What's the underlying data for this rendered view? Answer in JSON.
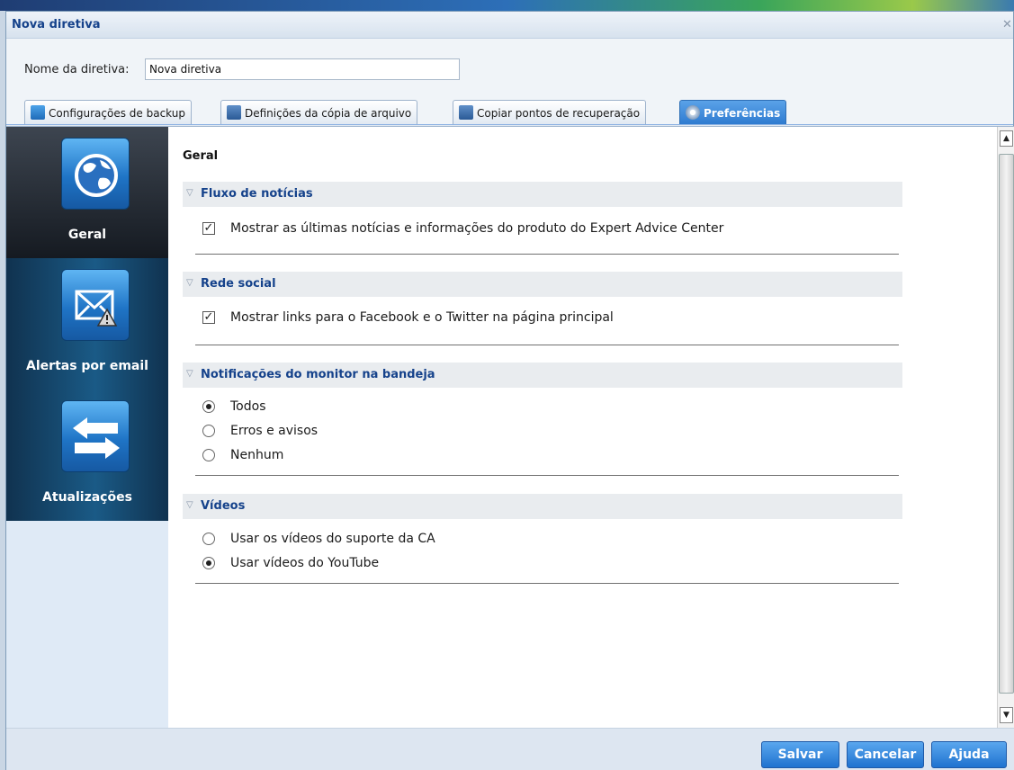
{
  "window": {
    "title": "Nova diretiva"
  },
  "name_row": {
    "label": "Nome da diretiva:",
    "value": "Nova diretiva"
  },
  "tabs": [
    {
      "label": "Configurações de backup",
      "icon": "backup-icon"
    },
    {
      "label": "Definições da cópia de arquivo",
      "icon": "file-copy-icon"
    },
    {
      "label": "Copiar pontos de recuperação",
      "icon": "recovery-points-icon"
    },
    {
      "label": "Preferências",
      "icon": "gear-icon",
      "active": true
    }
  ],
  "sidebar": {
    "items": [
      {
        "label": "Geral",
        "icon": "globe-icon",
        "active": true
      },
      {
        "label": "Alertas por email",
        "icon": "email-alert-icon",
        "active": false
      },
      {
        "label": "Atualizações",
        "icon": "updates-arrows-icon",
        "active": false
      }
    ]
  },
  "main": {
    "heading": "Geral",
    "sections": {
      "news": {
        "title": "Fluxo de notícias",
        "options": [
          {
            "label": "Mostrar as últimas notícias e informações do produto do Expert Advice Center",
            "checked": true
          }
        ]
      },
      "social": {
        "title": "Rede social",
        "options": [
          {
            "label": "Mostrar links para o Facebook e o Twitter na página principal",
            "checked": true
          }
        ]
      },
      "tray": {
        "title": "Notificações do monitor na bandeja",
        "options": [
          {
            "label": "Todos",
            "selected": true
          },
          {
            "label": "Erros e avisos",
            "selected": false
          },
          {
            "label": "Nenhum",
            "selected": false
          }
        ]
      },
      "videos": {
        "title": "Vídeos",
        "options": [
          {
            "label": "Usar os vídeos do suporte da CA",
            "selected": false
          },
          {
            "label": "Usar vídeos do YouTube",
            "selected": true
          }
        ]
      }
    }
  },
  "footer": {
    "save": "Salvar",
    "cancel": "Cancelar",
    "help": "Ajuda"
  },
  "colors": {
    "accent": "#2f7bd0",
    "section_title": "#15428b",
    "sidebar_dark": "#10324f"
  }
}
